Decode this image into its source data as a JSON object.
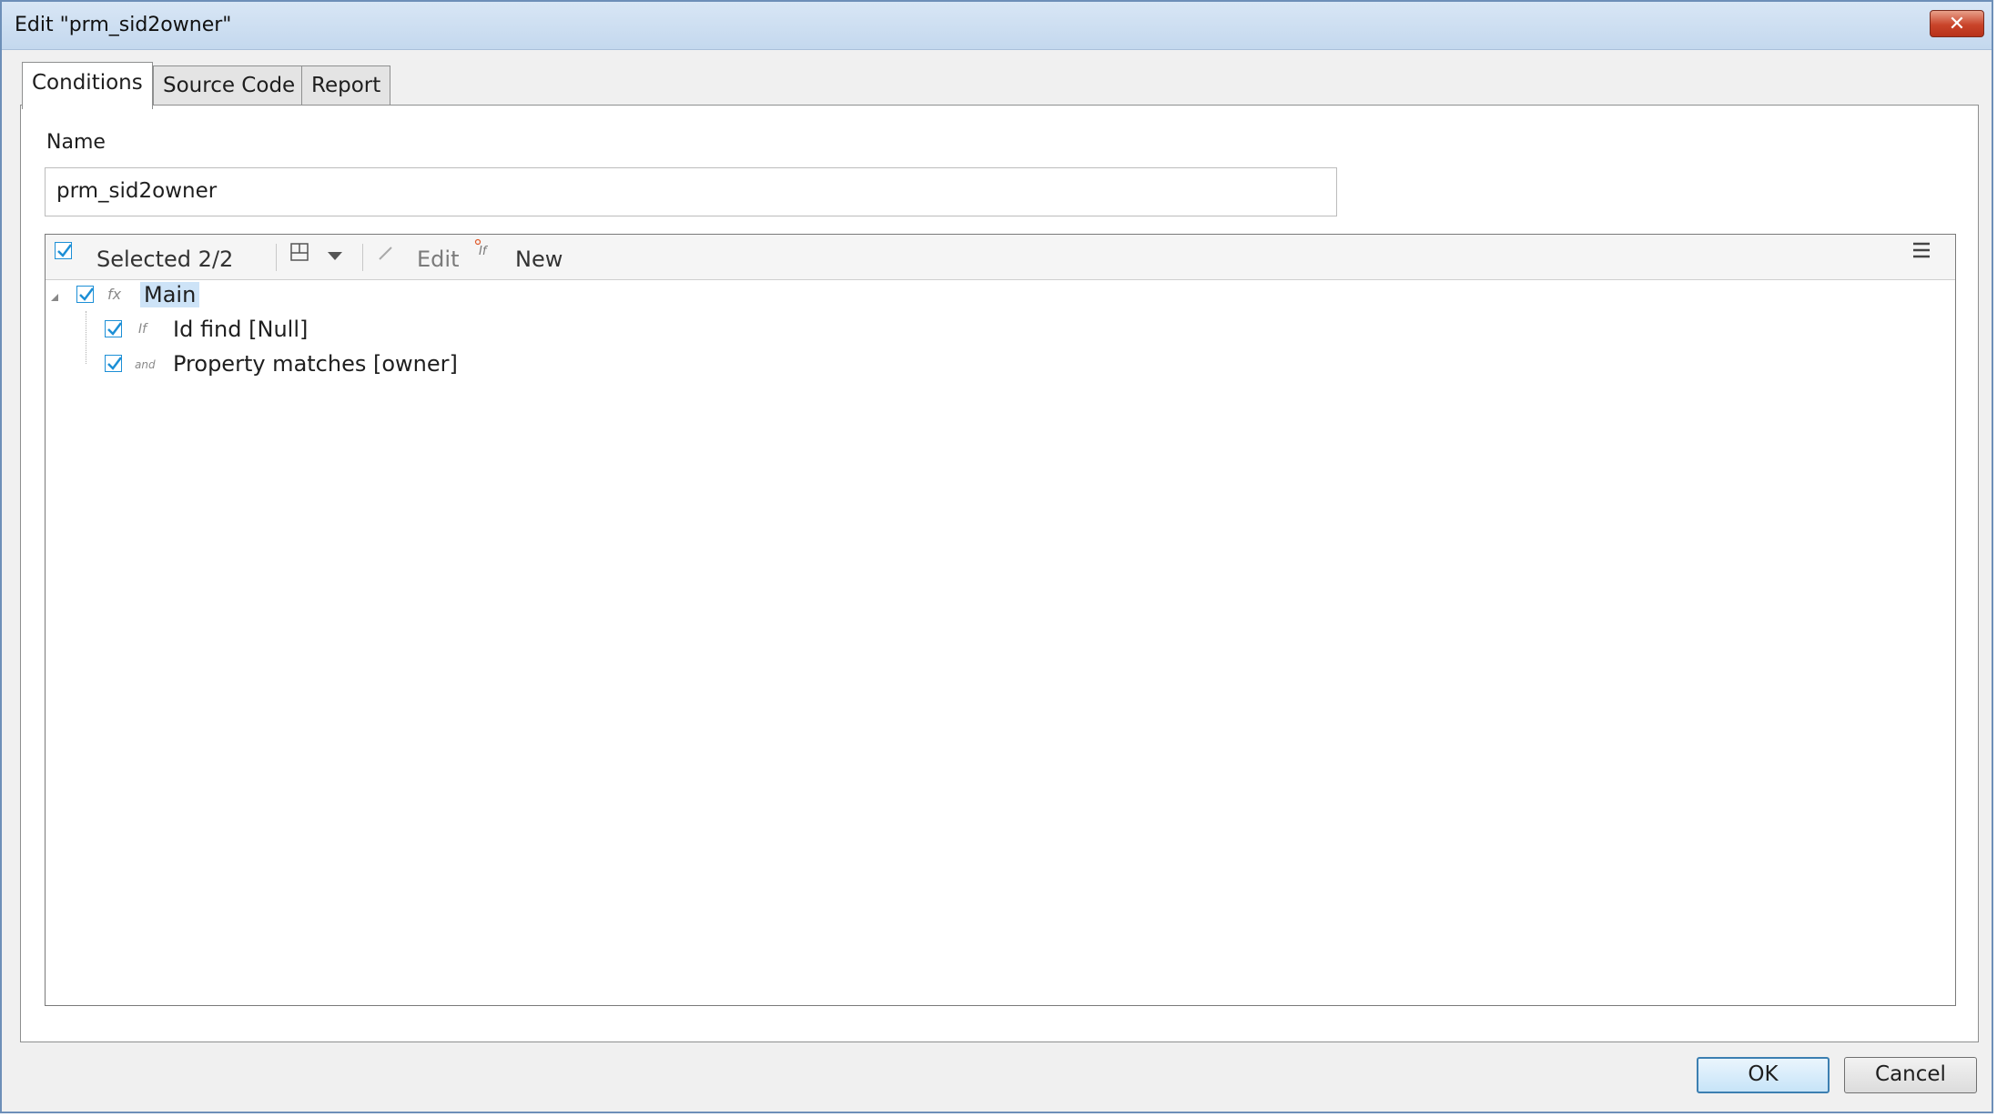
{
  "window": {
    "title": "Edit \"prm_sid2owner\"",
    "close_glyph": "✕"
  },
  "tabs": [
    {
      "label": "Conditions",
      "active": true
    },
    {
      "label": "Source Code",
      "active": false
    },
    {
      "label": "Report",
      "active": false
    }
  ],
  "name_field": {
    "label": "Name",
    "value": "prm_sid2owner"
  },
  "toolbar": {
    "selected_label": "Selected 2/2",
    "edit_label": "Edit",
    "new_label": "New",
    "icons": [
      "checkbox-icon",
      "layout-icon",
      "dropdown-arrow-icon",
      "pencil-icon",
      "if-new-icon",
      "menu-icon"
    ]
  },
  "tree": {
    "root": {
      "label": "Main",
      "icon": "fx-icon",
      "icon_text": "fx",
      "checked": true,
      "expanded": true,
      "selected": true
    },
    "children": [
      {
        "label": "Id find [Null]",
        "icon": "if-icon",
        "icon_text": "If",
        "checked": true
      },
      {
        "label": "Property matches [owner]",
        "icon": "and-icon",
        "icon_text": "and",
        "checked": true
      }
    ]
  },
  "buttons": {
    "ok": "OK",
    "cancel": "Cancel"
  },
  "colors": {
    "accent": "#1c8fd6",
    "selection": "#cde3f7",
    "titlebar": "#c4d8ee",
    "close": "#c9442a"
  }
}
